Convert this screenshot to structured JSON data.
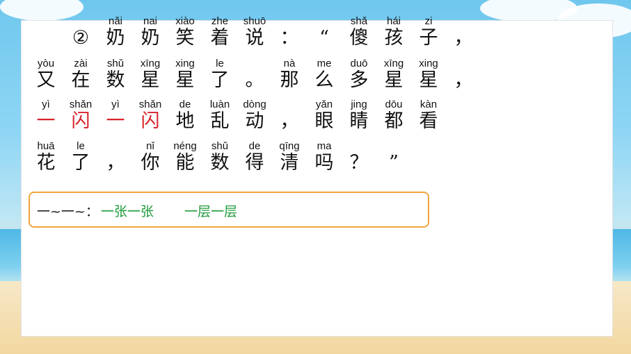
{
  "colors": {
    "highlight": "#d8232a",
    "example": "#1f9a3b",
    "box_border": "#f0a43b"
  },
  "lines": [
    [
      {
        "py": "",
        "hz": "②"
      },
      {
        "py": "nǎi",
        "hz": "奶"
      },
      {
        "py": "nai",
        "hz": "奶"
      },
      {
        "py": "xiào",
        "hz": "笑"
      },
      {
        "py": "zhe",
        "hz": "着"
      },
      {
        "py": "shuō",
        "hz": "说"
      },
      {
        "py": "",
        "hz": "："
      },
      {
        "py": "",
        "hz": "“"
      },
      {
        "py": "shǎ",
        "hz": "傻"
      },
      {
        "py": "hái",
        "hz": "孩"
      },
      {
        "py": "zi",
        "hz": "子"
      },
      {
        "py": "",
        "hz": "，"
      }
    ],
    [
      {
        "py": "yòu",
        "hz": "又"
      },
      {
        "py": "zài",
        "hz": "在"
      },
      {
        "py": "shǔ",
        "hz": "数"
      },
      {
        "py": "xīng",
        "hz": "星"
      },
      {
        "py": "xing",
        "hz": "星"
      },
      {
        "py": "le",
        "hz": "了"
      },
      {
        "py": "",
        "hz": "。"
      },
      {
        "py": "nà",
        "hz": "那"
      },
      {
        "py": "me",
        "hz": "么"
      },
      {
        "py": "duō",
        "hz": "多"
      },
      {
        "py": "xīng",
        "hz": "星"
      },
      {
        "py": "xing",
        "hz": "星"
      },
      {
        "py": "",
        "hz": "，"
      }
    ],
    [
      {
        "py": "yì",
        "hz": "一",
        "red": true
      },
      {
        "py": "shǎn",
        "hz": "闪",
        "red": true
      },
      {
        "py": "yì",
        "hz": "一",
        "red": true
      },
      {
        "py": "shǎn",
        "hz": "闪",
        "red": true
      },
      {
        "py": "de",
        "hz": "地"
      },
      {
        "py": "luàn",
        "hz": "乱"
      },
      {
        "py": "dòng",
        "hz": "动"
      },
      {
        "py": "",
        "hz": "，"
      },
      {
        "py": "yǎn",
        "hz": "眼"
      },
      {
        "py": "jing",
        "hz": "睛"
      },
      {
        "py": "dōu",
        "hz": "都"
      },
      {
        "py": "kàn",
        "hz": "看"
      }
    ],
    [
      {
        "py": "huā",
        "hz": "花"
      },
      {
        "py": "le",
        "hz": "了"
      },
      {
        "py": "",
        "hz": "，"
      },
      {
        "py": "nǐ",
        "hz": "你"
      },
      {
        "py": "néng",
        "hz": "能"
      },
      {
        "py": "shǔ",
        "hz": "数"
      },
      {
        "py": "de",
        "hz": "得"
      },
      {
        "py": "qīng",
        "hz": "清"
      },
      {
        "py": "ma",
        "hz": "吗"
      },
      {
        "py": "",
        "hz": "？"
      },
      {
        "py": "",
        "hz": "”"
      }
    ]
  ],
  "tip": {
    "label": "一~一~：",
    "example1": "一张一张",
    "example2": "一层一层"
  }
}
